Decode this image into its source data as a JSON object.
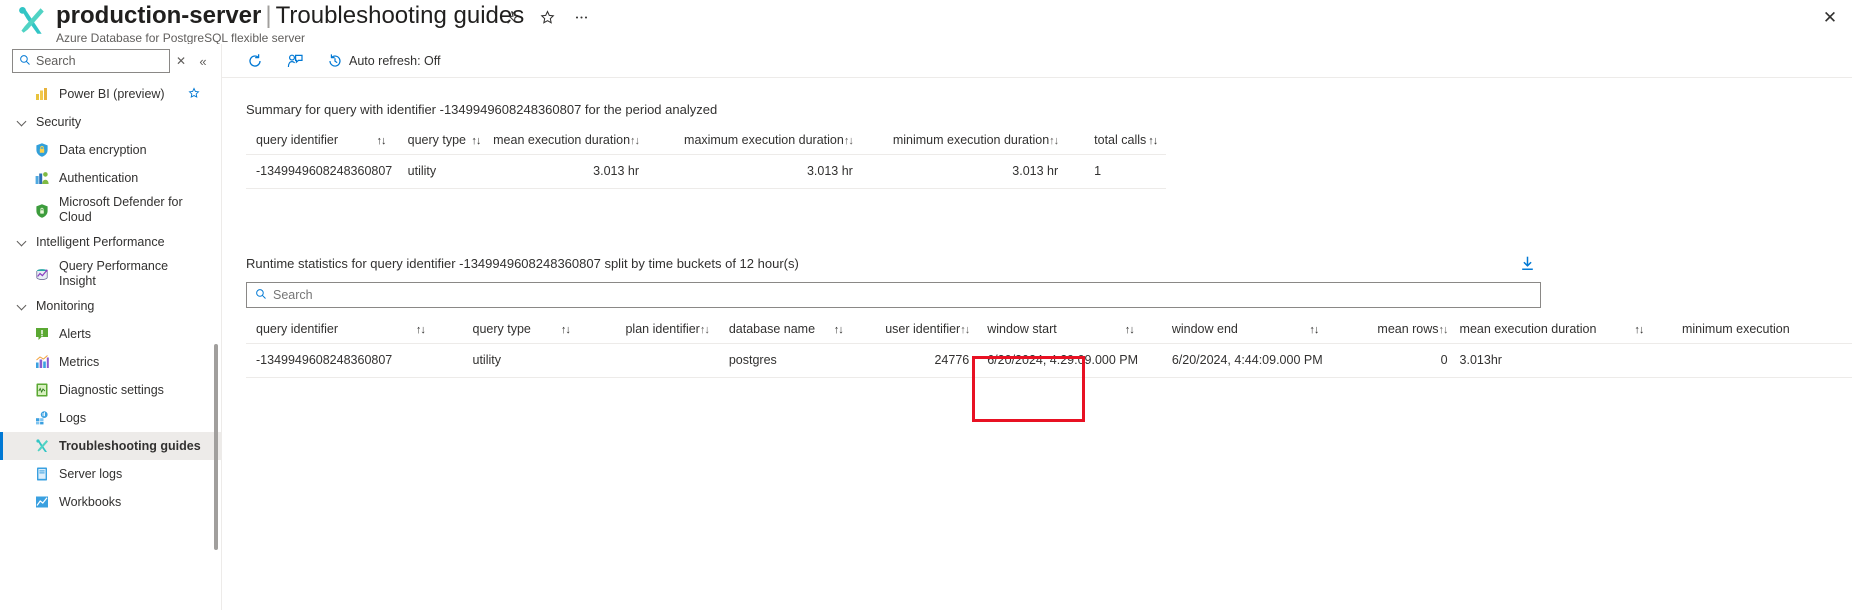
{
  "header": {
    "resource_icon": "wrench-screwdriver-icon",
    "title_resource": "production-server",
    "title_separator": "|",
    "title_page": "Troubleshooting guides",
    "subtitle": "Azure Database for PostgreSQL flexible server",
    "actions": [
      {
        "name": "pin-icon",
        "glyph": "📌"
      },
      {
        "name": "favorite-star-icon",
        "glyph": "☆"
      },
      {
        "name": "more-ellipsis-icon",
        "glyph": "⋯"
      }
    ],
    "close_label": "✕"
  },
  "sidebar": {
    "search": {
      "placeholder": "Search",
      "value": ""
    },
    "clear_label": "✕",
    "collapse_label": "«",
    "items": [
      {
        "label": "Power BI (preview)",
        "icon": "power-bi-icon",
        "type": "item",
        "favorite": true,
        "selected": false
      },
      {
        "label": "Security",
        "icon": "chevron-down-icon",
        "type": "group"
      },
      {
        "label": "Data encryption",
        "icon": "shield-lock-icon",
        "type": "item",
        "selected": false
      },
      {
        "label": "Authentication",
        "icon": "authentication-icon",
        "type": "item",
        "selected": false
      },
      {
        "label": "Microsoft Defender for Cloud",
        "icon": "defender-shield-icon",
        "type": "item",
        "selected": false
      },
      {
        "label": "Intelligent Performance",
        "icon": "chevron-down-icon",
        "type": "group"
      },
      {
        "label": "Query Performance Insight",
        "icon": "query-performance-icon",
        "type": "item",
        "selected": false
      },
      {
        "label": "Monitoring",
        "icon": "chevron-down-icon",
        "type": "group"
      },
      {
        "label": "Alerts",
        "icon": "alerts-icon",
        "type": "item",
        "selected": false
      },
      {
        "label": "Metrics",
        "icon": "metrics-chart-icon",
        "type": "item",
        "selected": false
      },
      {
        "label": "Diagnostic settings",
        "icon": "diagnostic-settings-icon",
        "type": "item",
        "selected": false
      },
      {
        "label": "Logs",
        "icon": "logs-icon",
        "type": "item",
        "selected": false
      },
      {
        "label": "Troubleshooting guides",
        "icon": "wrench-screwdriver-icon",
        "type": "item",
        "selected": true
      },
      {
        "label": "Server logs",
        "icon": "server-logs-icon",
        "type": "item",
        "selected": false
      },
      {
        "label": "Workbooks",
        "icon": "workbooks-icon",
        "type": "item",
        "selected": false
      }
    ]
  },
  "command_bar": [
    {
      "name": "refresh-button",
      "label": "",
      "icon": "refresh-icon"
    },
    {
      "name": "feedback-button",
      "label": "",
      "icon": "feedback-person-icon"
    },
    {
      "name": "auto-refresh-button",
      "label": "Auto refresh: Off",
      "icon": "clock-history-icon"
    }
  ],
  "summary_section": {
    "title": "Summary for query with identifier -1349949608248360807 for the period analyzed",
    "columns": [
      "query identifier",
      "query type",
      "mean execution duration",
      "maximum execution duration",
      "minimum execution duration",
      "total calls"
    ],
    "sort_glyph": "↑↓",
    "rows": [
      {
        "query_identifier": "-1349949608248360807",
        "query_type": "utility",
        "mean_execution_duration": "3.013 hr",
        "maximum_execution_duration": "3.013 hr",
        "minimum_execution_duration": "3.013 hr",
        "total_calls": "1"
      }
    ]
  },
  "runtime_section": {
    "title": "Runtime statistics for query identifier -1349949608248360807 split by time buckets of 12 hour(s)",
    "download_icon": "download-icon",
    "search": {
      "placeholder": "Search",
      "value": ""
    },
    "columns": [
      "query identifier",
      "query type",
      "plan identifier",
      "database name",
      "user identifier",
      "window start",
      "window end",
      "mean rows",
      "mean execution duration",
      "minimum execution"
    ],
    "sort_glyph": "↑↓",
    "highlighted_column": "user identifier",
    "highlight_color": "#e81123",
    "rows": [
      {
        "query_identifier": "-1349949608248360807",
        "query_type": "utility",
        "plan_identifier": "",
        "database_name": "postgres",
        "user_identifier": "24776",
        "window_start": "6/20/2024, 4:29:09.000 PM",
        "window_end": "6/20/2024, 4:44:09.000 PM",
        "mean_rows": "0",
        "mean_execution_duration": "3.013hr",
        "minimum_execution": ""
      }
    ]
  }
}
